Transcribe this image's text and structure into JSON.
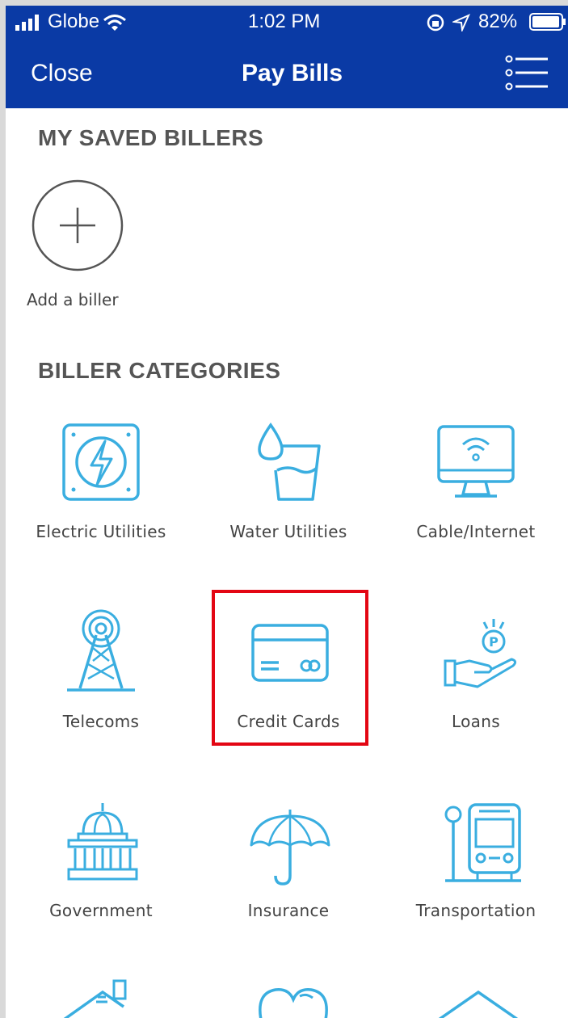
{
  "status_bar": {
    "carrier": "Globe",
    "time": "1:02 PM",
    "battery": "82%"
  },
  "nav": {
    "close_label": "Close",
    "title": "Pay Bills",
    "menu_icon": "list-menu-icon"
  },
  "saved_billers": {
    "title": "MY SAVED BILLERS",
    "add_label": "Add a biller"
  },
  "categories": {
    "title": "BILLER CATEGORIES",
    "items": [
      {
        "label": "Electric Utilities",
        "icon": "electric-icon"
      },
      {
        "label": "Water Utilities",
        "icon": "water-glass-icon"
      },
      {
        "label": "Cable/Internet",
        "icon": "monitor-wifi-icon"
      },
      {
        "label": "Telecoms",
        "icon": "tower-icon"
      },
      {
        "label": "Credit Cards",
        "icon": "credit-card-icon"
      },
      {
        "label": "Loans",
        "icon": "hand-coin-icon"
      },
      {
        "label": "Government",
        "icon": "government-building-icon"
      },
      {
        "label": "Insurance",
        "icon": "umbrella-icon"
      },
      {
        "label": "Transportation",
        "icon": "bus-icon"
      }
    ]
  },
  "colors": {
    "nav_bg": "#0a3aa5",
    "icon_blue": "#3aaee0",
    "highlight": "#e30613"
  }
}
